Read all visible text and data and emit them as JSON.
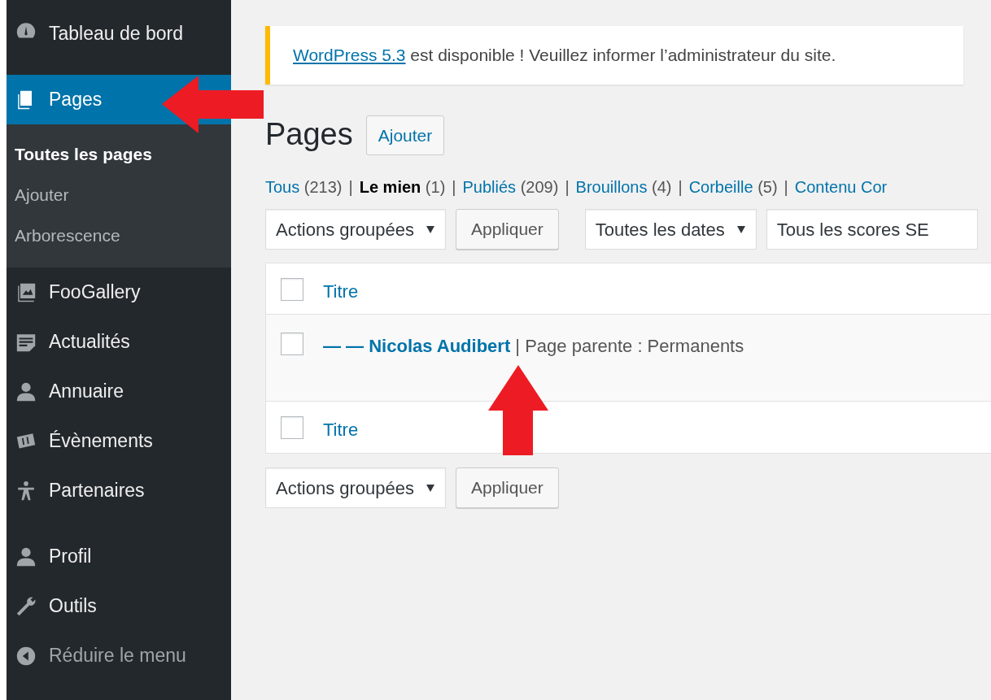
{
  "sidebar": {
    "groups": [
      [
        {
          "label": "Tableau de bord",
          "kind": "dashboard",
          "selected": false
        },
        {
          "label": "Pages",
          "kind": "pages",
          "selected": true,
          "children": [
            {
              "label": "Toutes les pages",
              "current": true
            },
            {
              "label": "Ajouter",
              "current": false
            },
            {
              "label": "Arborescence",
              "current": false
            }
          ]
        },
        {
          "label": "FooGallery",
          "kind": "gallery",
          "selected": false
        },
        {
          "label": "Actualités",
          "kind": "news",
          "selected": false
        },
        {
          "label": "Annuaire",
          "kind": "person",
          "selected": false
        },
        {
          "label": "Évènements",
          "kind": "events",
          "selected": false
        },
        {
          "label": "Partenaires",
          "kind": "accessibility",
          "selected": false
        }
      ],
      [
        {
          "label": "Profil",
          "kind": "person",
          "selected": false
        },
        {
          "label": "Outils",
          "kind": "wrench",
          "selected": false
        }
      ]
    ],
    "collapse": "Réduire le menu"
  },
  "notice": {
    "link": "WordPress 5.3",
    "text": " est disponible ! Veuillez informer l’administrateur du site."
  },
  "heading": "Pages",
  "add_button": "Ajouter",
  "filters": [
    {
      "label": "Tous",
      "count": "(213)",
      "current": false,
      "sep": "|"
    },
    {
      "label": "Le mien",
      "count": "(1)",
      "current": true,
      "sep": "|"
    },
    {
      "label": "Publiés",
      "count": "(209)",
      "current": false,
      "sep": "|"
    },
    {
      "label": "Brouillons",
      "count": "(4)",
      "current": false,
      "sep": "|"
    },
    {
      "label": "Corbeille",
      "count": "(5)",
      "current": false,
      "sep": "|"
    },
    {
      "label": "Contenu Cor",
      "current": false
    }
  ],
  "top_controls": {
    "bulk": "Actions groupées",
    "apply": "Appliquer",
    "dates": "Toutes les dates",
    "seo": "Tous les scores SE"
  },
  "table": {
    "header": {
      "checked": false,
      "label": "Titre"
    },
    "rows": [
      {
        "checked": false,
        "prefix": "— —",
        "title": "Nicolas Audibert",
        "state": "| Page parente : Permanents"
      }
    ],
    "footer": {
      "checked": false,
      "label": "Titre"
    }
  },
  "bottom_controls": {
    "bulk": "Actions groupées",
    "apply": "Appliquer"
  },
  "annotations": [
    {
      "kind": "left"
    },
    {
      "kind": "up"
    }
  ]
}
